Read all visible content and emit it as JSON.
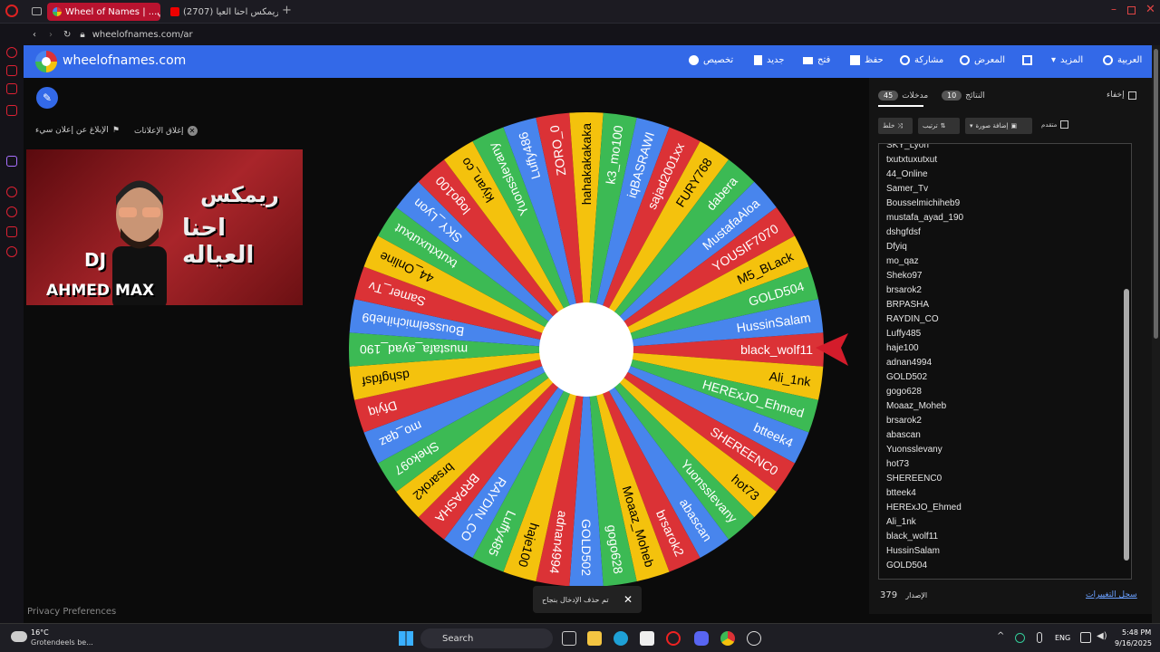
{
  "browser": {
    "tabs": [
      {
        "label": "Wheel of Names | ...اتي"
      },
      {
        "label": "(2707) ريمكس احنا العيا..."
      }
    ],
    "url": "wheelofnames.com/ar"
  },
  "header": {
    "site_title": "wheelofnames.com",
    "nav": {
      "customize": "تخصيص",
      "new": "جديد",
      "open": "فتح",
      "save": "حفظ",
      "share": "مشاركة",
      "gallery": "المعرض",
      "more": "المزيد",
      "language": "العربية"
    }
  },
  "ads": {
    "report": "الإبلاغ عن إعلان سيء",
    "close": "إغلاق الإعلانات",
    "line1": "ريمكس",
    "line2": "احنا العياله",
    "dj": "DJ",
    "artist": "AHMED MAX"
  },
  "privacy": "Privacy Preferences",
  "toast": {
    "text": "تم حذف الإدخال بنجاح"
  },
  "panel": {
    "hide": "إخفاء",
    "tab_results": "النتائج",
    "results_count": "10",
    "tab_entries": "مدخلات",
    "entries_count": "45",
    "shuffle": "خلط",
    "sort": "ترتيب",
    "add_image": "إضافة صورة",
    "advanced": "متقدم",
    "version_label": "الإصدار",
    "version": "379",
    "changelog": "سجل التغييرات",
    "entries": [
      "SKY_Lyon",
      "txutxtuxutxut",
      "44_Online",
      "Samer_Tv",
      "Bousselmichiheb9",
      "mustafa_ayad_190",
      "dshgfdsf",
      "Dfyiq",
      "mo_qaz",
      "Sheko97",
      "brsarok2",
      "BRPASHA",
      "RAYDIN_CO",
      "Luffy485",
      "haje100",
      "adnan4994",
      "GOLD502",
      "gogo628",
      "Moaaz_Moheb",
      "brsarok2",
      "abascan",
      "Yuonsslevany",
      "hot73",
      "SHEREENC0",
      "btteek4",
      "HERExJO_Ehmed",
      "Ali_1nk",
      "black_wolf11",
      "HussinSalam",
      "GOLD504"
    ]
  },
  "wheel": {
    "colors": [
      "#db3236",
      "#f4c20d",
      "#3cba54",
      "#4885ed"
    ],
    "slices": [
      "black_wolf11",
      "Ali_1nk",
      "HERExJO_Ehmed",
      "btteek4",
      "SHEREENC0",
      "hot73",
      "Yuonsslevany",
      "abascan",
      "brsarok2",
      "Moaaz_Moheb",
      "gogo628",
      "GOLD502",
      "adnan4994",
      "haje100",
      "Luffy485",
      "RAYDIN_CO",
      "BRPASHA",
      "brsarok2",
      "Sheko97",
      "mo_qaz",
      "Dfyiq",
      "dshgfdsf",
      "mustafa_ayad_190",
      "Bousselmichiheb9",
      "Samer_Tv",
      "44_Online",
      "txutxtuxutxut",
      "SKY_Lyon",
      "logo100",
      "kiyan_co",
      "Yuonsslevany",
      "Luffy486",
      "ZORO_0",
      "hahakakakaka",
      "k3_mo100",
      "iqBASRAWI",
      "sajad2001xx",
      "FURY768",
      "dabera",
      "MustafaAloa",
      "YOUSIF7070",
      "M5_BLack",
      "GOLD504",
      "HussinSalam"
    ]
  },
  "taskbar": {
    "weather_temp": "16°C",
    "weather_desc": "Grotendeels be...",
    "search": "Search",
    "lang": "ENG",
    "time": "5:48 PM",
    "date": "9/16/2025"
  }
}
